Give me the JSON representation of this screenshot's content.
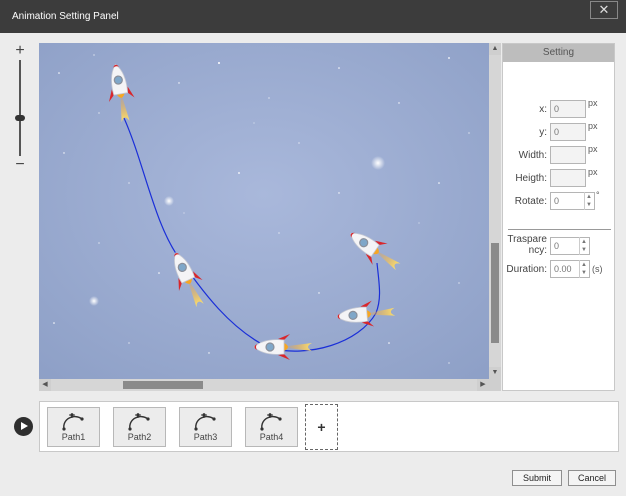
{
  "window": {
    "title": "Animation Setting Panel",
    "close_symbol": "✕"
  },
  "zoom": {
    "plus": "+",
    "minus": "−"
  },
  "settings": {
    "header": "Setting",
    "fields": [
      {
        "label": "x:",
        "value": "0",
        "unit": "px"
      },
      {
        "label": "y:",
        "value": "0",
        "unit": "px"
      },
      {
        "label": "Width:",
        "value": "",
        "unit": "px"
      },
      {
        "label": "Heigth:",
        "value": "",
        "unit": "px"
      },
      {
        "label": "Rotate:",
        "value": "0",
        "unit": "°"
      }
    ],
    "transparency": {
      "label_line1": "Traspare",
      "label_line2": "ncy:",
      "value": "0"
    },
    "duration": {
      "label": "Duration:",
      "value": "0.00",
      "unit": "(s)"
    }
  },
  "paths": [
    {
      "label": "Path1"
    },
    {
      "label": "Path2"
    },
    {
      "label": "Path3"
    },
    {
      "label": "Path4"
    }
  ],
  "add_path_symbol": "+",
  "buttons": {
    "submit": "Submit",
    "cancel": "Cancel"
  },
  "colors": {
    "path_line": "#1a2fd8",
    "rocket_fin": "#d9262b",
    "flame": "#f6a623",
    "sky": "#9fb0d4"
  }
}
